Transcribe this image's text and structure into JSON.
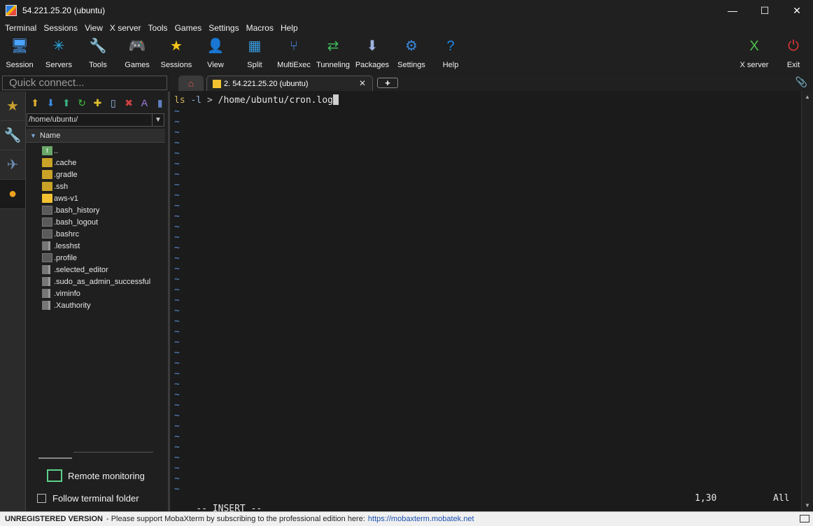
{
  "window": {
    "title": "54.221.25.20 (ubuntu)"
  },
  "window_controls": {
    "minimize": "—",
    "maximize": "☐",
    "close": "✕"
  },
  "menu": [
    "Terminal",
    "Sessions",
    "View",
    "X server",
    "Tools",
    "Games",
    "Settings",
    "Macros",
    "Help"
  ],
  "toolbar": [
    {
      "label": "Session",
      "icon": "🖥",
      "color": "#4aa3ff"
    },
    {
      "label": "Servers",
      "icon": "✳",
      "color": "#2ab0f0"
    },
    {
      "label": "Tools",
      "icon": "🔧",
      "color": "#e04040"
    },
    {
      "label": "Games",
      "icon": "🎮",
      "color": "#dddddd"
    },
    {
      "label": "Sessions",
      "icon": "★",
      "color": "#f5c518"
    },
    {
      "label": "View",
      "icon": "👤",
      "color": "#7fbf7f"
    },
    {
      "label": "Split",
      "icon": "▦",
      "color": "#3a9be0"
    },
    {
      "label": "MultiExec",
      "icon": "⑂",
      "color": "#4a80e0"
    },
    {
      "label": "Tunneling",
      "icon": "⇄",
      "color": "#3cba5a"
    },
    {
      "label": "Packages",
      "icon": "⬇",
      "color": "#9fb3e0"
    },
    {
      "label": "Settings",
      "icon": "⚙",
      "color": "#3a8be0"
    },
    {
      "label": "Help",
      "icon": "?",
      "color": "#1e88e5"
    }
  ],
  "toolbar_right": [
    {
      "label": "X server",
      "icon": "X",
      "color": "#4cc04c"
    },
    {
      "label": "Exit",
      "icon": "⏻",
      "color": "#e53935"
    }
  ],
  "quick_connect": {
    "placeholder": "Quick connect..."
  },
  "vertical_tabs": [
    {
      "icon": "★",
      "color": "#c8a030"
    },
    {
      "icon": "🔧",
      "color": "#c04040"
    },
    {
      "icon": "✈",
      "color": "#6a8ab0"
    },
    {
      "icon": "●",
      "color": "#f0a020"
    }
  ],
  "file_toolbar": [
    {
      "icon": "⬆",
      "color": "#e0b030"
    },
    {
      "icon": "⬇",
      "color": "#3a8be0"
    },
    {
      "icon": "⬆",
      "color": "#3ab080"
    },
    {
      "icon": "↻",
      "color": "#40c040"
    },
    {
      "icon": "✚",
      "color": "#e0c030"
    },
    {
      "icon": "▯",
      "color": "#9ab8f0"
    },
    {
      "icon": "✖",
      "color": "#d04040"
    },
    {
      "icon": "A",
      "color": "#a080e0"
    },
    {
      "icon": "▮",
      "color": "#6080c0"
    }
  ],
  "file_browser": {
    "path": "/home/ubuntu/",
    "column_name": "Name",
    "items": [
      {
        "name": "..",
        "type": "up"
      },
      {
        "name": ".cache",
        "type": "folder"
      },
      {
        "name": ".gradle",
        "type": "folder"
      },
      {
        "name": ".ssh",
        "type": "folder"
      },
      {
        "name": "aws-v1",
        "type": "folder-bright"
      },
      {
        "name": ".bash_history",
        "type": "file"
      },
      {
        "name": ".bash_logout",
        "type": "file"
      },
      {
        "name": ".bashrc",
        "type": "file"
      },
      {
        "name": ".lesshst",
        "type": "doc"
      },
      {
        "name": ".profile",
        "type": "file"
      },
      {
        "name": ".selected_editor",
        "type": "doc"
      },
      {
        "name": ".sudo_as_admin_successful",
        "type": "doc"
      },
      {
        "name": ".viminfo",
        "type": "doc"
      },
      {
        "name": ".Xauthority",
        "type": "doc"
      }
    ],
    "remote_monitoring": "Remote monitoring",
    "follow_terminal": "Follow terminal folder"
  },
  "tabs": {
    "home_icon": "⌂",
    "session_label": "2. 54.221.25.20 (ubuntu)",
    "close": "✕",
    "new_tab": "+",
    "attach_icon": "📎"
  },
  "terminal": {
    "cmd": "ls",
    "opt": " -l",
    "op": " >",
    "arg": " /home/ubuntu/cron.log",
    "tilde_count": 37,
    "mode": "-- INSERT --",
    "position": "1,30",
    "scroll": "All"
  },
  "bottom_bar": {
    "unregistered": "UNREGISTERED VERSION",
    "message": "-  Please support MobaXterm by subscribing to the professional edition here:",
    "link": "https://mobaxterm.mobatek.net"
  }
}
